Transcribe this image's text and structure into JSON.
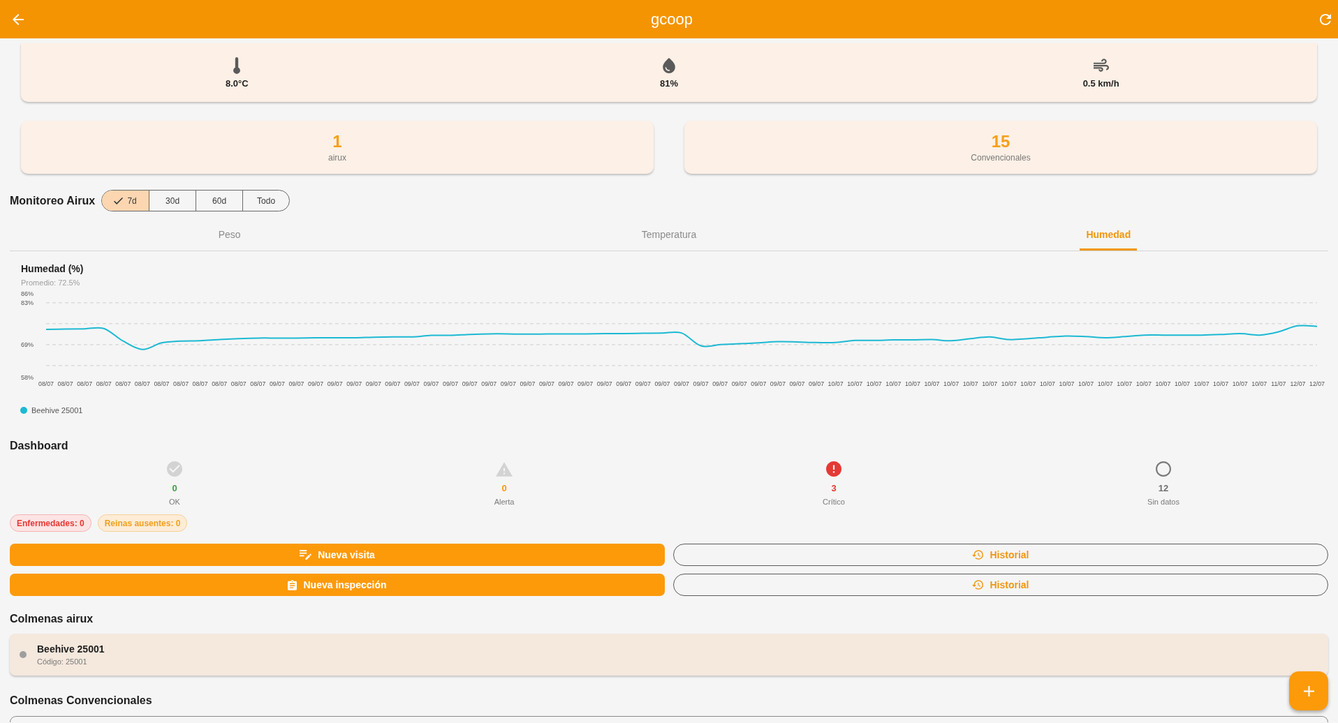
{
  "app_bar": {
    "title": "gcoop"
  },
  "weather": [
    {
      "kind": "temperature",
      "value": "8.0°C"
    },
    {
      "kind": "humidity",
      "value": "81%"
    },
    {
      "kind": "wind",
      "value": "0.5 km/h"
    }
  ],
  "counts": [
    {
      "value": "1",
      "label": "airux"
    },
    {
      "value": "15",
      "label": "Convencionales"
    }
  ],
  "monitoring": {
    "title": "Monitoreo Airux",
    "ranges": [
      {
        "label": "7d",
        "selected": true
      },
      {
        "label": "30d",
        "selected": false
      },
      {
        "label": "60d",
        "selected": false
      },
      {
        "label": "Todo",
        "selected": false
      }
    ],
    "tabs": [
      {
        "label": "Peso",
        "selected": false
      },
      {
        "label": "Temperatura",
        "selected": false
      },
      {
        "label": "Humedad",
        "selected": true
      }
    ],
    "chart": {
      "average": "Promedio: 72.5%",
      "chart_data": {
        "type": "line",
        "title": "Humedad (%)",
        "categories": [
          "08/07",
          "08/07",
          "08/07",
          "08/07",
          "08/07",
          "08/07",
          "08/07",
          "08/07",
          "08/07",
          "08/07",
          "08/07",
          "08/07",
          "09/07",
          "09/07",
          "09/07",
          "09/07",
          "09/07",
          "09/07",
          "09/07",
          "09/07",
          "09/07",
          "09/07",
          "09/07",
          "09/07",
          "09/07",
          "09/07",
          "09/07",
          "09/07",
          "09/07",
          "09/07",
          "09/07",
          "09/07",
          "09/07",
          "09/07",
          "09/07",
          "09/07",
          "09/07",
          "09/07",
          "09/07",
          "09/07",
          "09/07",
          "10/07",
          "10/07",
          "10/07",
          "10/07",
          "10/07",
          "10/07",
          "10/07",
          "10/07",
          "10/07",
          "10/07",
          "10/07",
          "10/07",
          "10/07",
          "10/07",
          "10/07",
          "10/07",
          "10/07",
          "10/07",
          "10/07",
          "10/07",
          "10/07",
          "10/07",
          "10/07",
          "11/07",
          "12/07",
          "12/07"
        ],
        "ylim": [
          58,
          86
        ],
        "yticks": [
          {
            "value": 58,
            "label": "58%"
          },
          {
            "value": 69,
            "label": "69%"
          },
          {
            "value": 83,
            "label": "83%"
          },
          {
            "value": 86,
            "label": "86%"
          }
        ],
        "series": [
          {
            "name": "Beehive 25001",
            "color": "#1cb9d3",
            "values": [
              74.1,
              74.2,
              74.3,
              74.4,
              70.2,
              67.4,
              69.6,
              70.2,
              70.3,
              70.7,
              71.0,
              71.2,
              71.2,
              71.2,
              71.3,
              71.3,
              71.3,
              71.5,
              71.6,
              71.6,
              72.1,
              72.1,
              72.4,
              72.6,
              72.6,
              72.5,
              72.6,
              72.6,
              72.6,
              72.7,
              72.7,
              72.8,
              72.9,
              72.9,
              68.6,
              69.0,
              69.3,
              69.6,
              70.0,
              69.9,
              69.7,
              69.7,
              70.4,
              70.4,
              70.6,
              70.6,
              70.7,
              70.3,
              71.0,
              71.6,
              70.7,
              71.0,
              71.5,
              71.9,
              71.7,
              71.3,
              71.7,
              72.2,
              72.2,
              72.2,
              72.2,
              72.4,
              72.7,
              72.2,
              73.3,
              75.3,
              75.1
            ]
          }
        ]
      }
    }
  },
  "dashboard": {
    "title": "Dashboard",
    "statuses": [
      {
        "kind": "ok",
        "count": "0",
        "label": "OK"
      },
      {
        "kind": "alert",
        "count": "0",
        "label": "Alerta"
      },
      {
        "kind": "critical",
        "count": "3",
        "label": "Crítico"
      },
      {
        "kind": "no_data",
        "count": "12",
        "label": "Sin datos"
      }
    ],
    "chips": [
      {
        "kind": "danger",
        "label": "Enfermedades: 0"
      },
      {
        "kind": "warning",
        "label": "Reinas ausentes: 0"
      }
    ],
    "actions": [
      {
        "kind": "visit",
        "label": "Nueva visita"
      },
      {
        "kind": "history",
        "label": "Historial"
      },
      {
        "kind": "inspection",
        "label": "Nueva inspección"
      },
      {
        "kind": "history",
        "label": "Historial"
      }
    ]
  },
  "airux_hives": {
    "title": "Colmenas airux",
    "items": [
      {
        "name": "Beehive 25001",
        "code": "Código: 25001",
        "color": "#9e9e9e"
      }
    ]
  },
  "conventional_hives": {
    "title": "Colmenas Convencionales"
  }
}
